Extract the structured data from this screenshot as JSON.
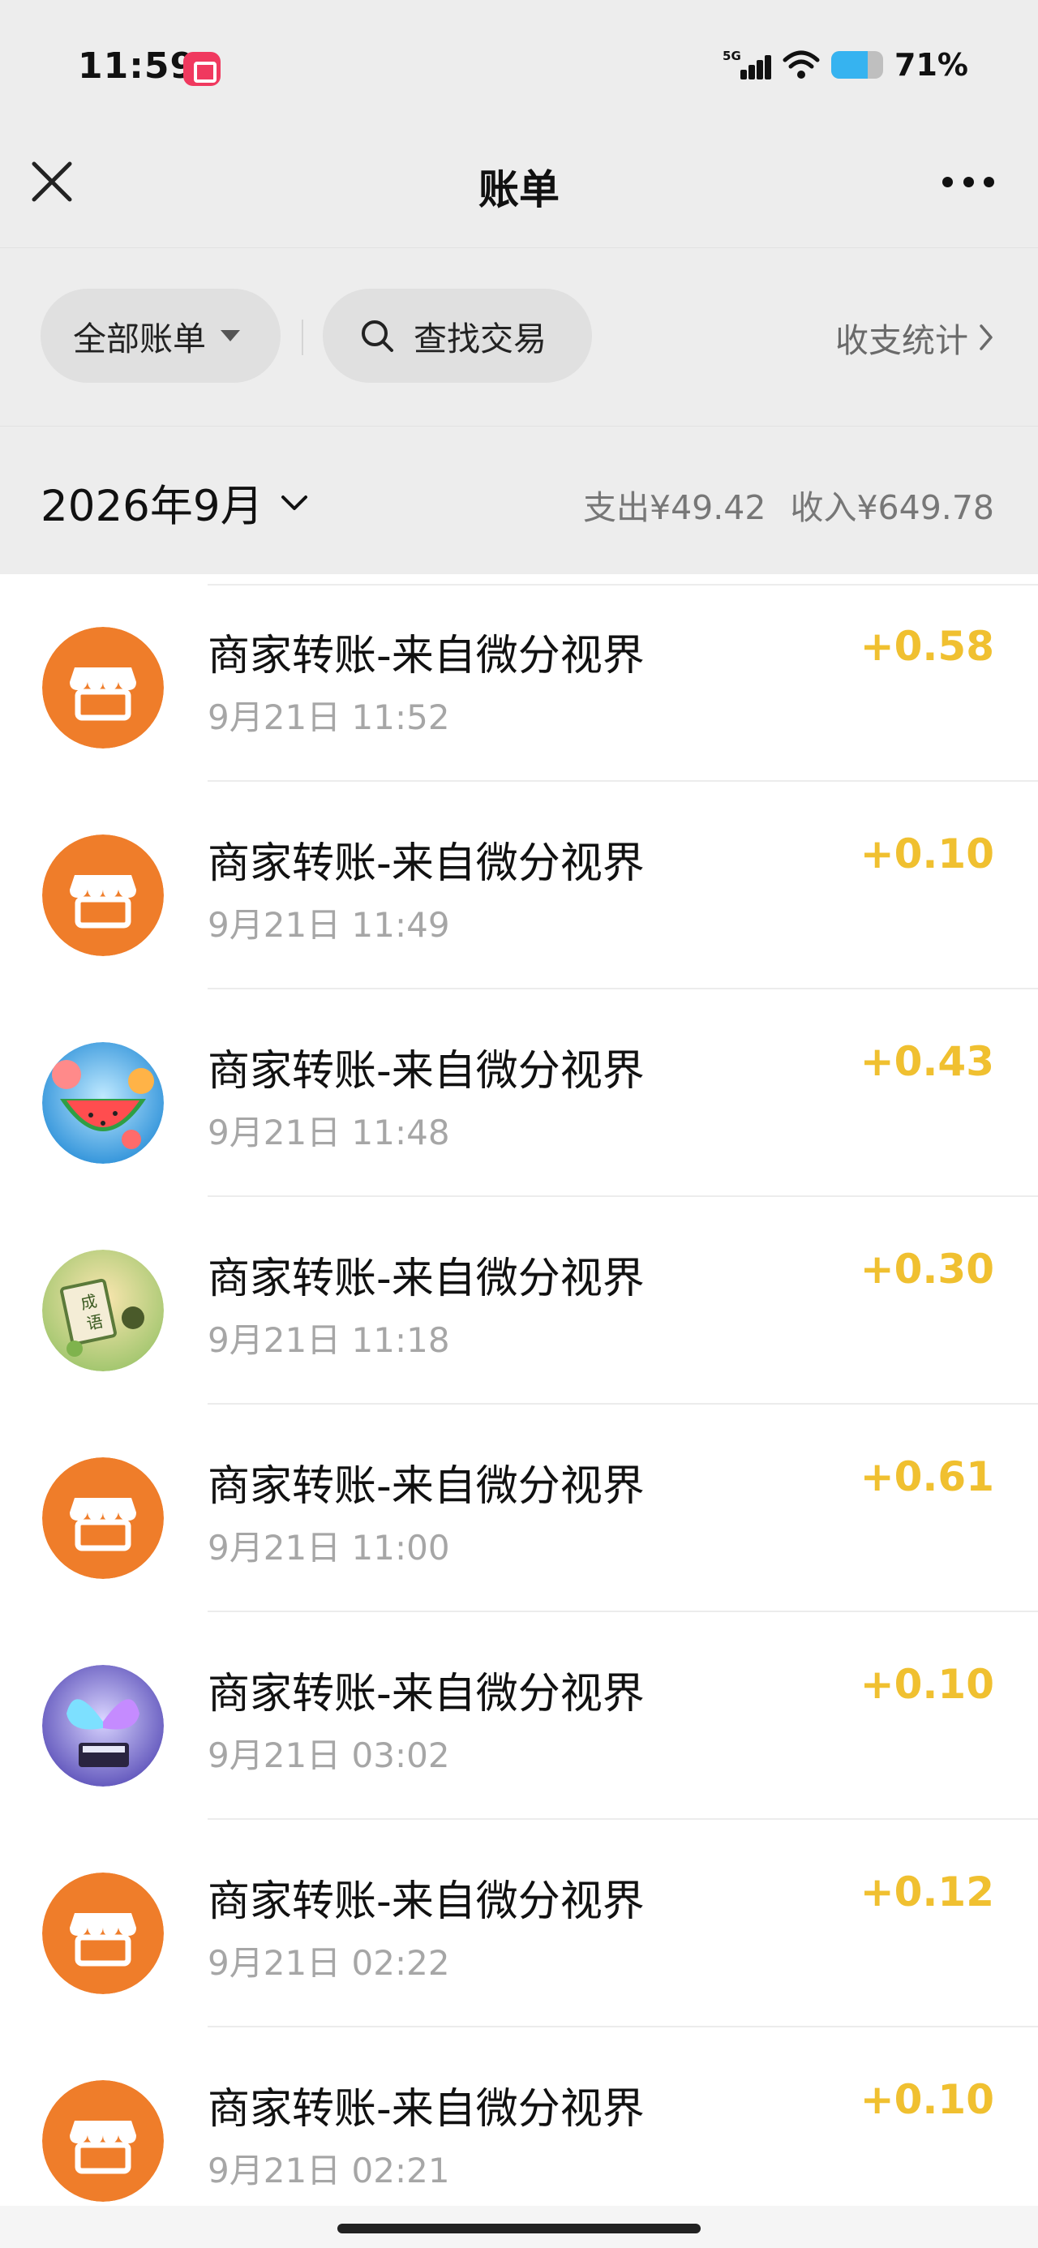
{
  "status": {
    "time": "11:59",
    "network": "5G",
    "battery_text": "71%",
    "battery_level": 0.71,
    "battery_color": "#36b3f0"
  },
  "nav": {
    "title": "账单"
  },
  "filters": {
    "all_bills": "全部账单",
    "search": "查找交易",
    "stats": "收支统计"
  },
  "month": {
    "label": "2026年9月",
    "expense": "支出¥49.42",
    "income": "收入¥649.78"
  },
  "colors": {
    "amount": "#f0c030",
    "store_orange": "#ef7d2a"
  },
  "transactions": [
    {
      "title": "商家转账-来自微分视界",
      "time": "9月21日 11:52",
      "amount": "+0.58",
      "avatar": "store-icon"
    },
    {
      "title": "商家转账-来自微分视界",
      "time": "9月21日 11:49",
      "amount": "+0.10",
      "avatar": "store-icon"
    },
    {
      "title": "商家转账-来自微分视界",
      "time": "9月21日 11:48",
      "amount": "+0.43",
      "avatar": "watermelon-game-icon"
    },
    {
      "title": "商家转账-来自微分视界",
      "time": "9月21日 11:18",
      "amount": "+0.30",
      "avatar": "idiom-game-icon",
      "avatar_text": "成语"
    },
    {
      "title": "商家转账-来自微分视界",
      "time": "9月21日 11:00",
      "amount": "+0.61",
      "avatar": "store-icon"
    },
    {
      "title": "商家转账-来自微分视界",
      "time": "9月21日 03:02",
      "amount": "+0.10",
      "avatar": "butterfly-piano-icon"
    },
    {
      "title": "商家转账-来自微分视界",
      "time": "9月21日 02:22",
      "amount": "+0.12",
      "avatar": "store-icon"
    },
    {
      "title": "商家转账-来自微分视界",
      "time": "9月21日 02:21",
      "amount": "+0.10",
      "avatar": "store-icon"
    }
  ]
}
